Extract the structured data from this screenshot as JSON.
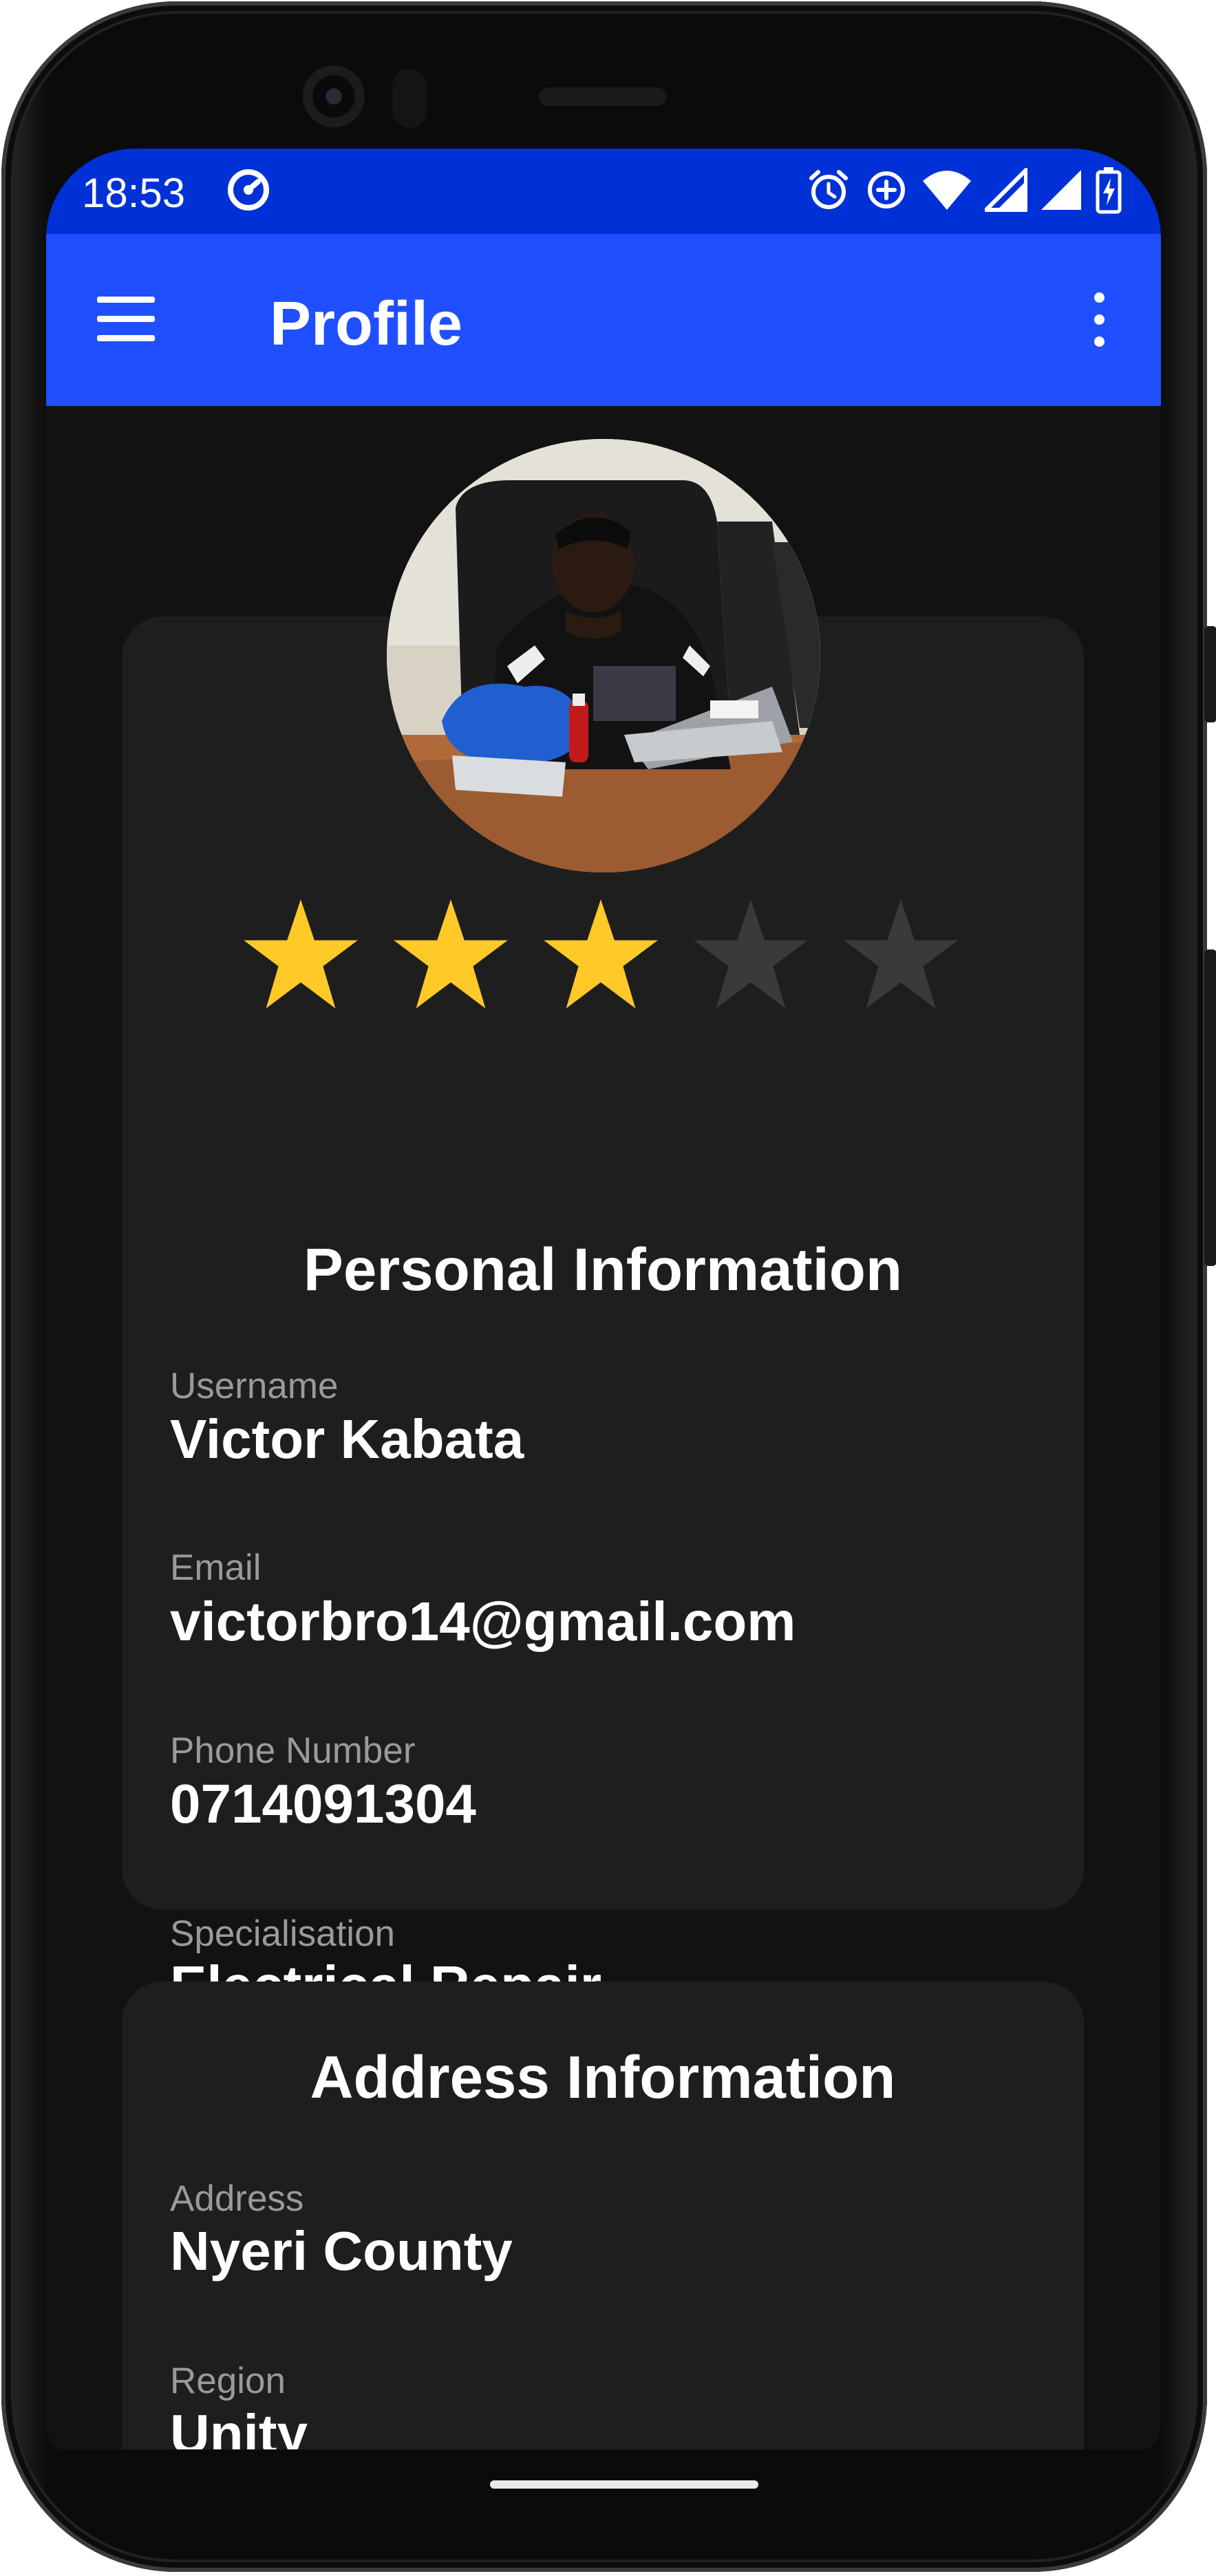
{
  "status_bar": {
    "time": "18:53",
    "left_icons": [
      "app-notification-icon"
    ],
    "right_icons": [
      "alarm-icon",
      "data-saver-icon",
      "wifi-icon",
      "signal-icon",
      "signal-icon",
      "battery-charging-icon"
    ]
  },
  "app_bar": {
    "title": "Profile",
    "menu_icon": "hamburger-menu-icon",
    "overflow_icon": "more-vert-icon"
  },
  "profile": {
    "rating": 3,
    "rating_max": 5,
    "star_filled_color": "#FFC928",
    "star_empty_color": "#3A3A3A"
  },
  "personal_information": {
    "title": "Personal Information",
    "username_label": "Username",
    "username": "Victor Kabata",
    "email_label": "Email",
    "email": "victorbro14@gmail.com",
    "phone_label": "Phone Number",
    "phone": "0714091304",
    "specialisation_label": "Specialisation",
    "specialisation": "Electrical Repair"
  },
  "address_information": {
    "title": "Address Information",
    "address_label": "Address",
    "address": "Nyeri County",
    "region_label": "Region",
    "region": "Unity"
  },
  "colors": {
    "status_bar": "#0031D6",
    "app_bar": "#1F4FFF",
    "background": "#121212",
    "card": "#1E1E1E"
  }
}
